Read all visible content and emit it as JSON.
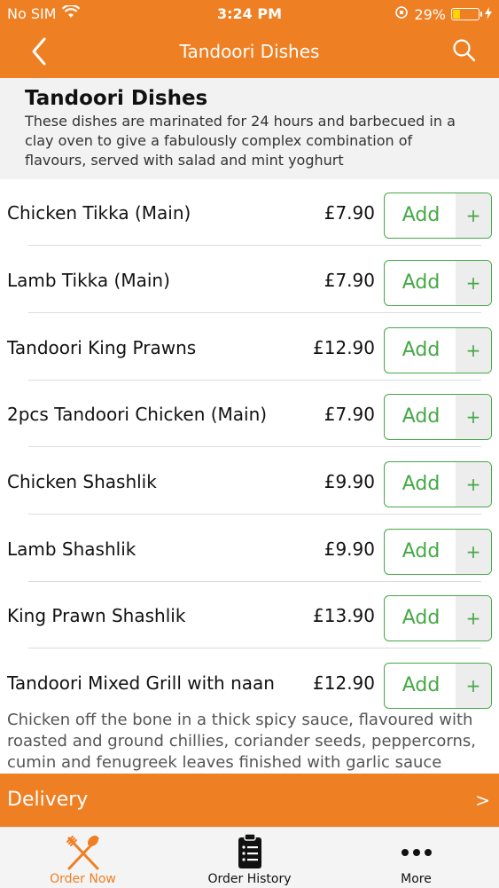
{
  "status": {
    "carrier": "No SIM",
    "time": "3:24 PM",
    "battery": "29%"
  },
  "nav": {
    "title": "Tandoori Dishes"
  },
  "section": {
    "title": "Tandoori Dishes",
    "description": " These dishes are marinated for 24 hours and barbecued in a clay oven to give a fabulously complex combination of flavours, served with salad and mint yoghurt"
  },
  "items": [
    {
      "name": "Chicken Tikka (Main)",
      "price": "£7.90",
      "add": "Add",
      "plus": "+"
    },
    {
      "name": "Lamb Tikka (Main)",
      "price": "£7.90",
      "add": "Add",
      "plus": "+"
    },
    {
      "name": "Tandoori King Prawns",
      "price": "£12.90",
      "add": "Add",
      "plus": "+"
    },
    {
      "name": "2pcs Tandoori Chicken (Main)",
      "price": "£7.90",
      "add": "Add",
      "plus": "+"
    },
    {
      "name": "Chicken Shashlik",
      "price": "£9.90",
      "add": "Add",
      "plus": "+"
    },
    {
      "name": "Lamb Shashlik",
      "price": "£9.90",
      "add": "Add",
      "plus": "+"
    },
    {
      "name": "King Prawn Shashlik",
      "price": "£13.90",
      "add": "Add",
      "plus": "+"
    },
    {
      "name": "Tandoori Mixed Grill with naan",
      "price": "£12.90",
      "add": "Add",
      "plus": "+"
    }
  ],
  "last_item_description": "Chicken off the bone in a thick spicy sauce, flavoured with roasted and ground chillies, coriander seeds, peppercorns, cumin and fenugreek leaves finished with garlic sauce",
  "delivery": {
    "label": "Delivery",
    "chevron": ">"
  },
  "tabs": [
    {
      "label": "Order Now",
      "icon": "fork-knife-icon",
      "active": true
    },
    {
      "label": "Order History",
      "icon": "clipboard-icon",
      "active": false
    },
    {
      "label": "More",
      "icon": "more-dots-icon",
      "active": false
    }
  ],
  "colors": {
    "accent": "#ef7f23",
    "add_green": "#45a845"
  }
}
